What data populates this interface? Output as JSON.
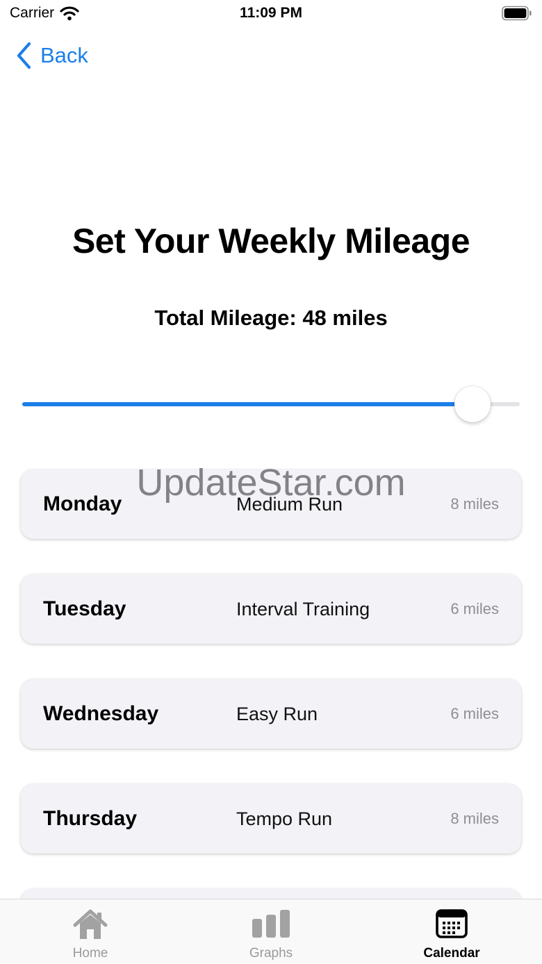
{
  "status_bar": {
    "carrier": "Carrier",
    "time": "11:09 PM"
  },
  "nav": {
    "back_label": "Back"
  },
  "page": {
    "title": "Set Your Weekly Mileage",
    "total_label": "Total Mileage: 48 miles"
  },
  "slider": {
    "value_fraction": 0.905,
    "accent": "#1a7fe8"
  },
  "schedule": [
    {
      "day": "Monday",
      "workout": "Medium Run",
      "miles": "8 miles"
    },
    {
      "day": "Tuesday",
      "workout": "Interval Training",
      "miles": "6 miles"
    },
    {
      "day": "Wednesday",
      "workout": "Easy Run",
      "miles": "6 miles"
    },
    {
      "day": "Thursday",
      "workout": "Tempo Run",
      "miles": "8 miles"
    },
    {
      "day": "",
      "workout": "",
      "miles": ""
    }
  ],
  "watermark": "UpdateStar.com",
  "tabbar": {
    "tabs": [
      {
        "label": "Home",
        "icon": "house-icon"
      },
      {
        "label": "Graphs",
        "icon": "bar-chart-icon"
      },
      {
        "label": "Calendar",
        "icon": "calendar-icon"
      }
    ],
    "active": "Calendar"
  }
}
